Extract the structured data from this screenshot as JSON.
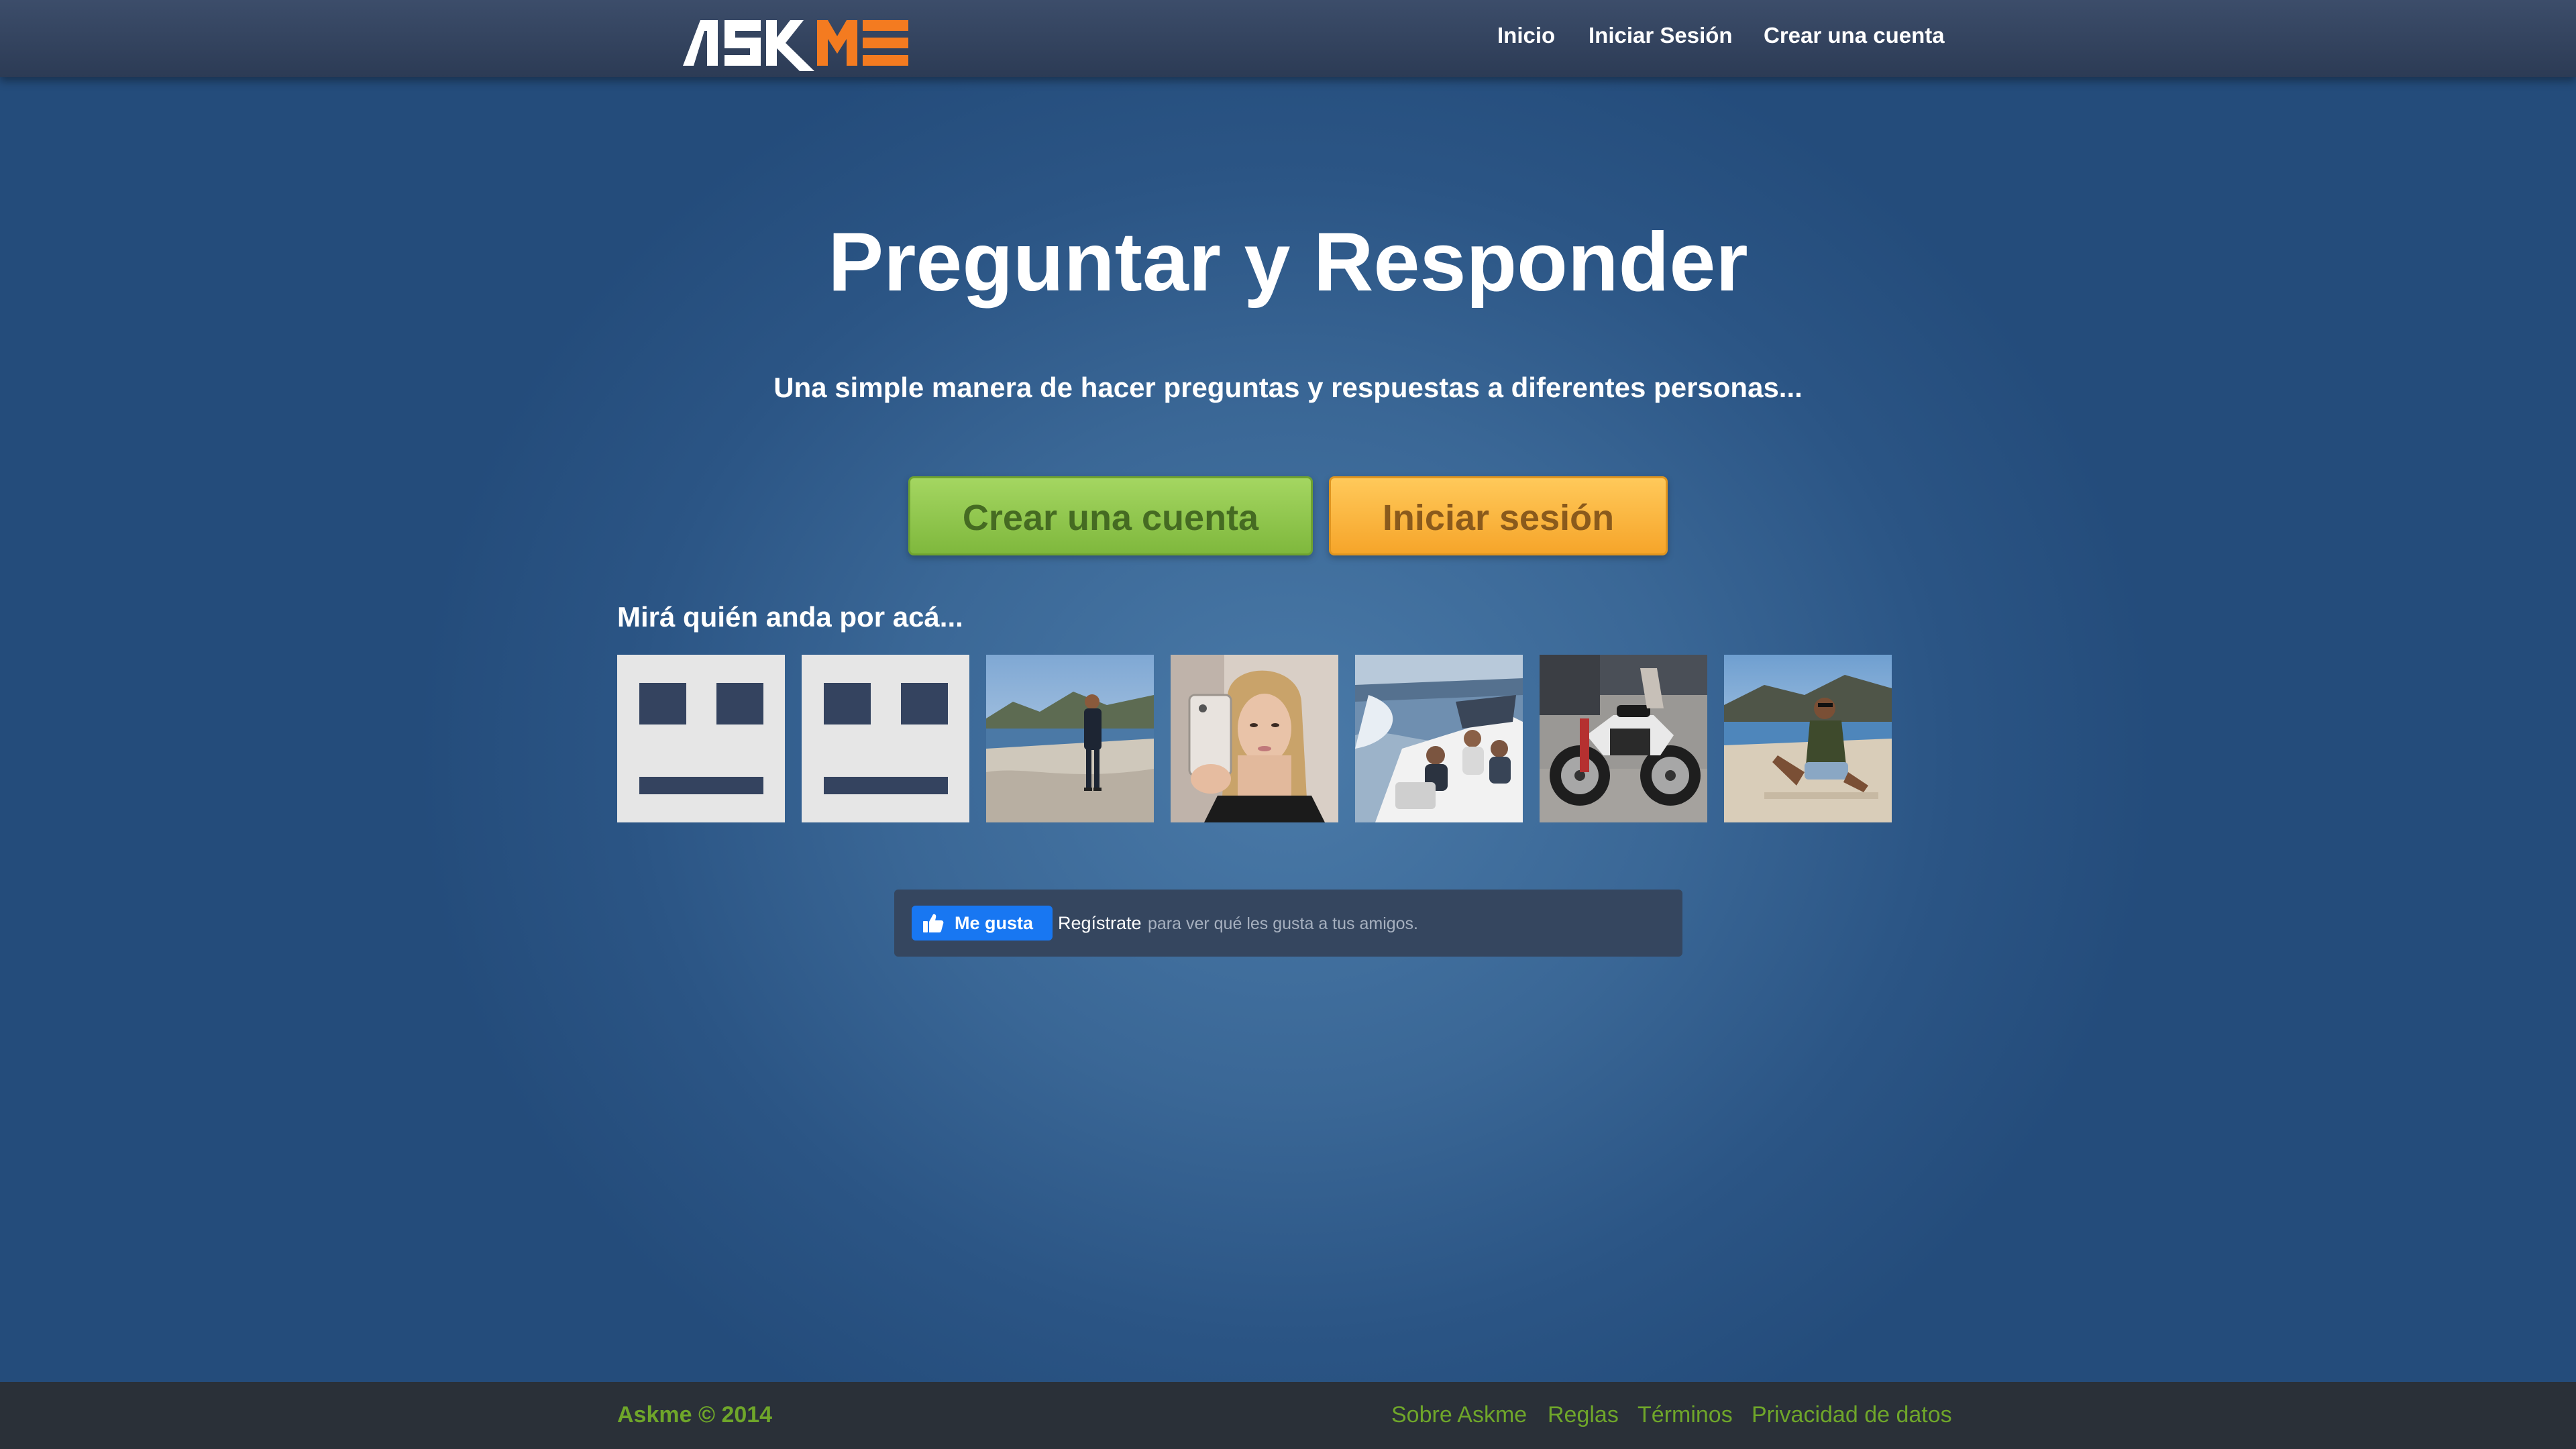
{
  "header": {
    "logo_text": "ASKME",
    "nav": {
      "home": "Inicio",
      "login": "Iniciar Sesión",
      "register": "Crear una cuenta"
    }
  },
  "hero": {
    "title": "Preguntar y Responder",
    "subtitle": "Una simple manera de hacer preguntas y respuestas a diferentes personas...",
    "create_account_button": "Crear una cuenta",
    "login_button": "Iniciar sesión"
  },
  "users": {
    "heading": "Mirá quién anda por acá...",
    "avatars": [
      {
        "kind": "default-avatar"
      },
      {
        "kind": "default-avatar"
      },
      {
        "kind": "photo-man-on-beach"
      },
      {
        "kind": "photo-woman-selfie"
      },
      {
        "kind": "photo-people-on-boat"
      },
      {
        "kind": "photo-motorcycle"
      },
      {
        "kind": "photo-man-sitting-on-beach"
      }
    ]
  },
  "facebook": {
    "like_label": "Me gusta",
    "signup_link": "Regístrate",
    "rest_text": "para ver qué les gusta a tus amigos."
  },
  "footer": {
    "copyright": "Askme © 2014",
    "links": {
      "about": "Sobre Askme",
      "rules": "Reglas",
      "terms": "Términos",
      "privacy": "Privacidad de datos"
    }
  },
  "colors": {
    "background": "#2f5b8b",
    "header": "#34445f",
    "logo_accent": "#f47b20",
    "create_button": "#8cc64a",
    "login_button": "#fbb640",
    "footer": "#2a3038",
    "footer_text": "#6fa62a",
    "facebook_blue": "#1877f2"
  }
}
